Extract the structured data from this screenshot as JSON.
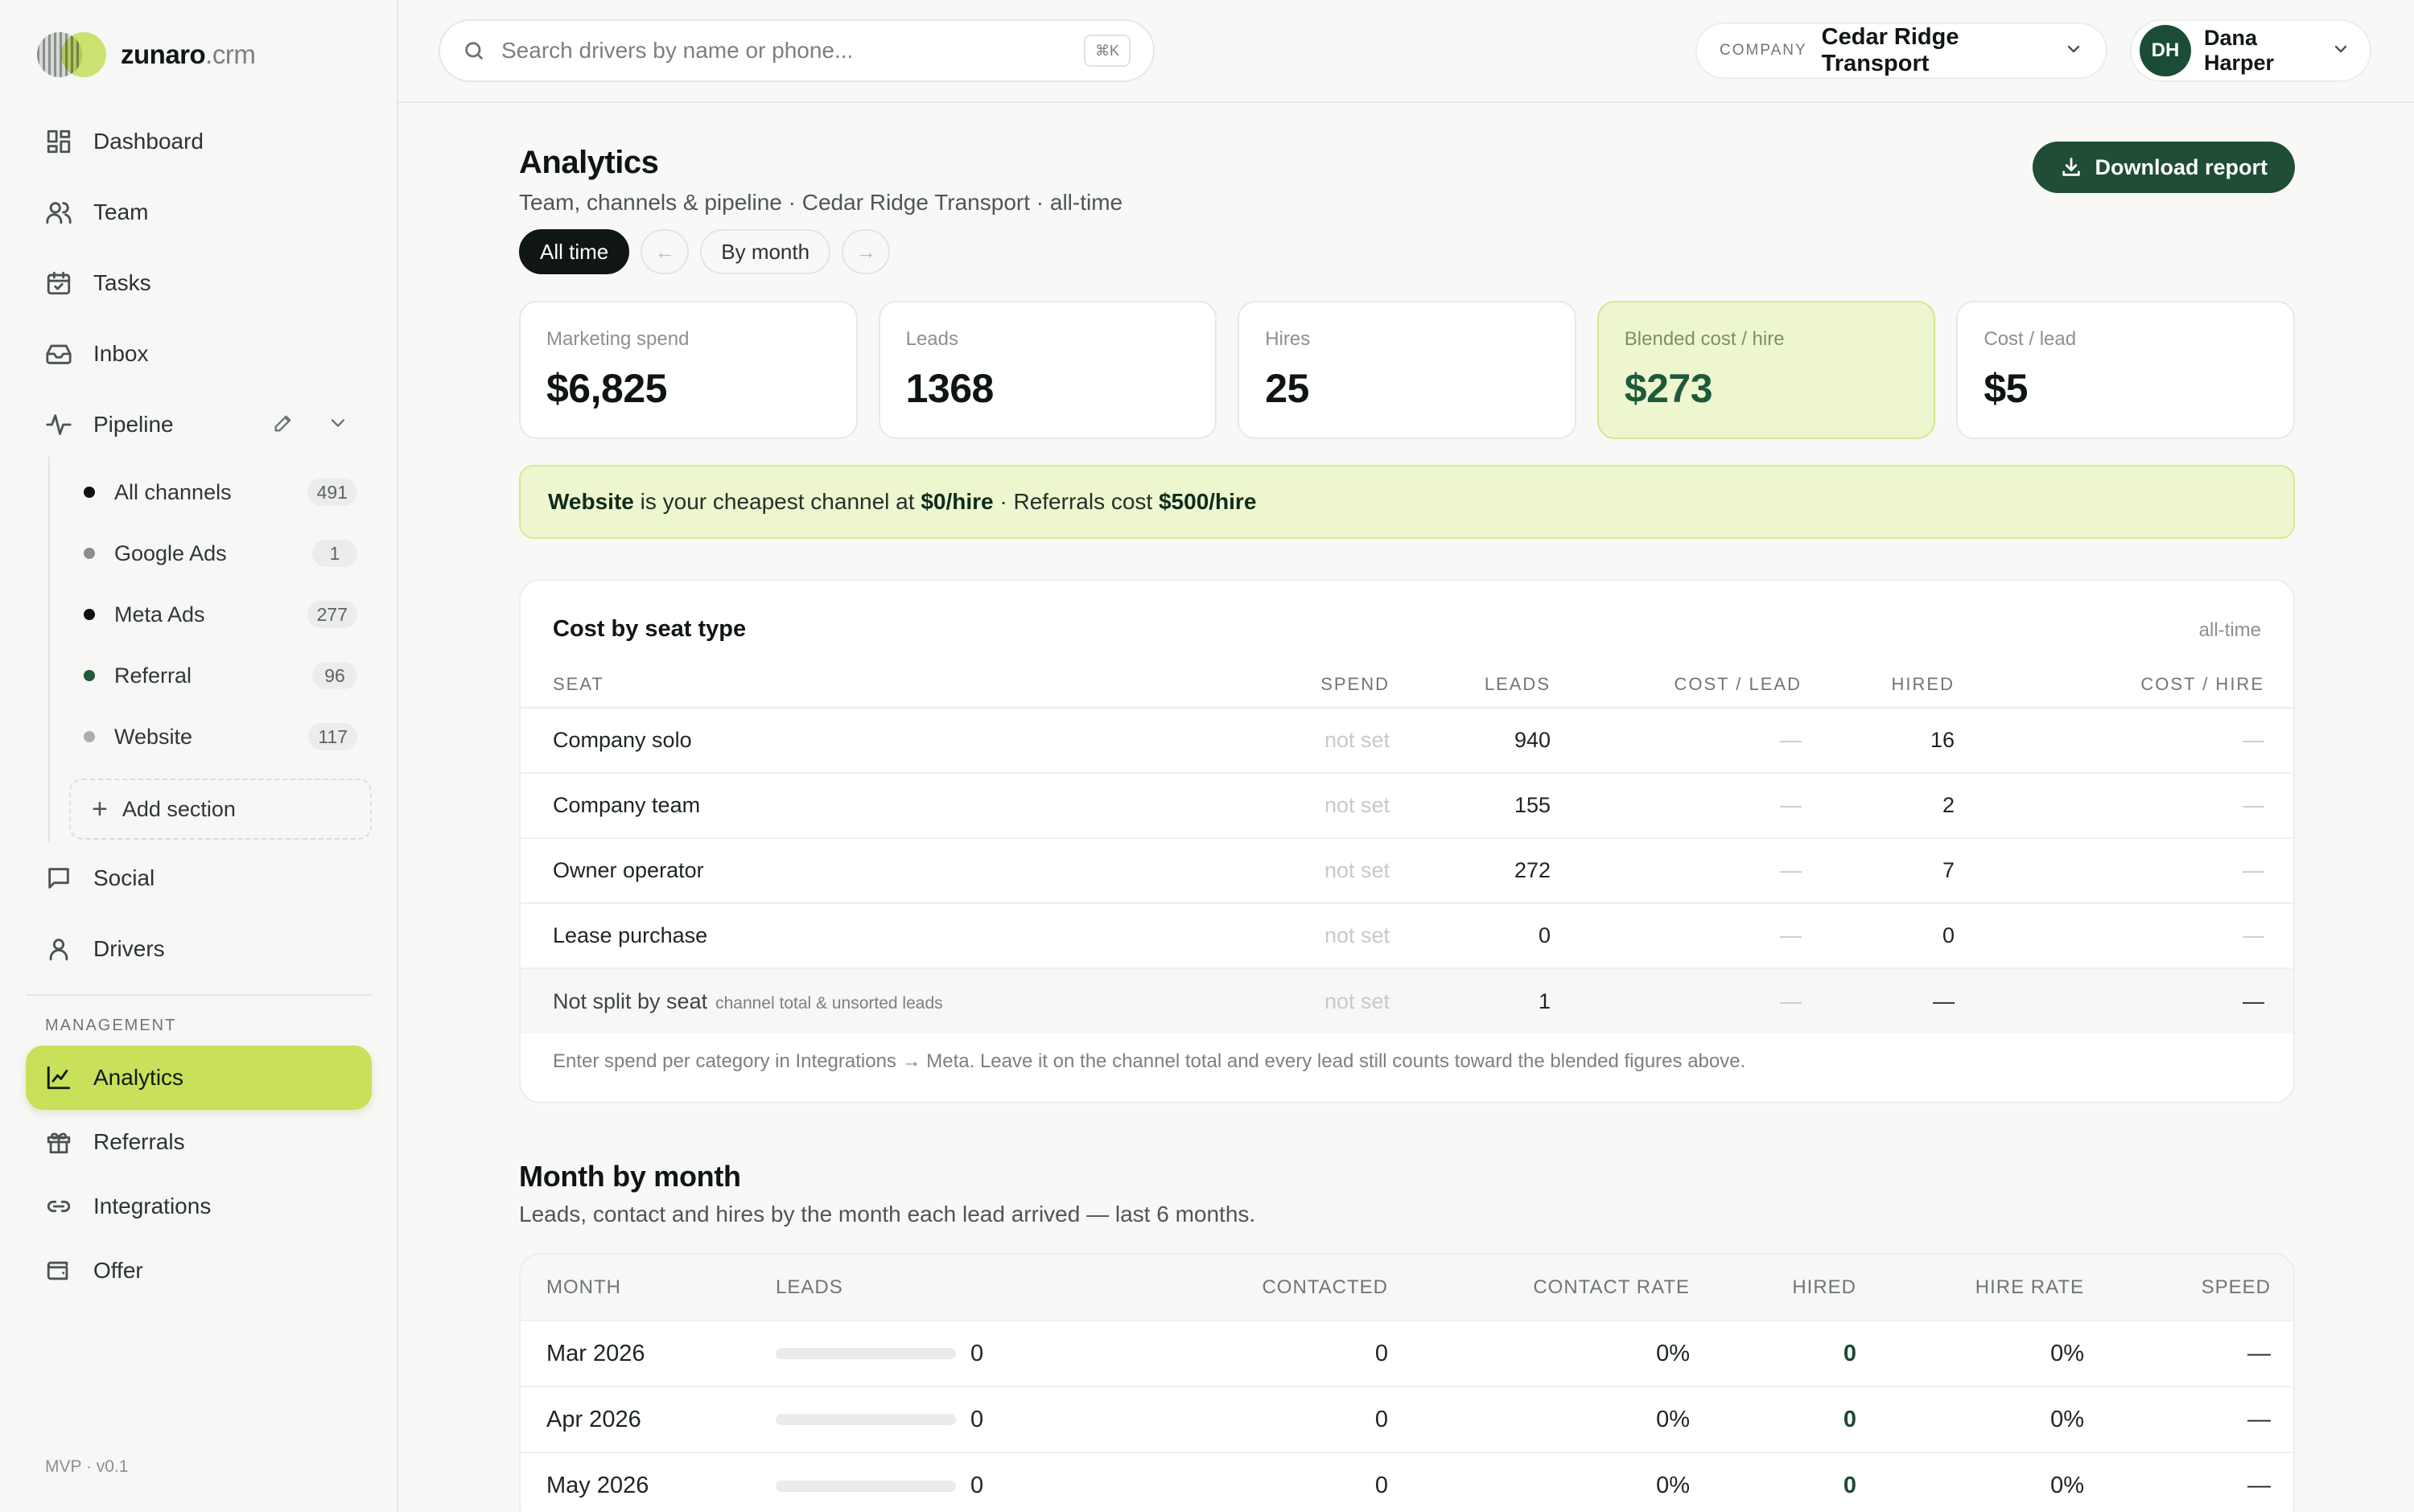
{
  "brand": {
    "name": "zunaro",
    "suffix": ".crm"
  },
  "sidebar": {
    "nav": [
      {
        "id": "dashboard",
        "label": "Dashboard",
        "icon": "grid-icon"
      },
      {
        "id": "team",
        "label": "Team",
        "icon": "users-icon"
      },
      {
        "id": "tasks",
        "label": "Tasks",
        "icon": "calendar-check-icon"
      },
      {
        "id": "inbox",
        "label": "Inbox",
        "icon": "inbox-icon"
      },
      {
        "id": "pipeline",
        "label": "Pipeline",
        "icon": "activity-icon"
      }
    ],
    "pipeline_sections": [
      {
        "label": "All channels",
        "count": "491",
        "dot_color": "#111111"
      },
      {
        "label": "Google Ads",
        "count": "1",
        "dot_color": "#8a8f8c"
      },
      {
        "label": "Meta Ads",
        "count": "277",
        "dot_color": "#111111"
      },
      {
        "label": "Referral",
        "count": "96",
        "dot_color": "#1f5a3a"
      },
      {
        "label": "Website",
        "count": "117",
        "dot_color": "#a9aeab"
      }
    ],
    "add_section_label": "Add section",
    "nav_after": [
      {
        "id": "social",
        "label": "Social",
        "icon": "message-icon"
      },
      {
        "id": "drivers",
        "label": "Drivers",
        "icon": "user-icon"
      }
    ],
    "management_label": "MANAGEMENT",
    "management": [
      {
        "id": "analytics",
        "label": "Analytics",
        "icon": "chart-line-icon",
        "active": true
      },
      {
        "id": "referrals",
        "label": "Referrals",
        "icon": "gift-icon"
      },
      {
        "id": "integrations",
        "label": "Integrations",
        "icon": "link-icon"
      },
      {
        "id": "offer",
        "label": "Offer",
        "icon": "wallet-icon"
      }
    ],
    "version": "MVP · v0.1"
  },
  "topbar": {
    "search_placeholder": "Search drivers by name or phone...",
    "search_shortcut": "⌘K",
    "company_label": "COMPANY",
    "company_value": "Cedar Ridge Transport",
    "user_initials": "DH",
    "user_name": "Dana Harper"
  },
  "page": {
    "title": "Analytics",
    "subtitle": "Team, channels & pipeline · Cedar Ridge Transport · all-time",
    "download_label": "Download report",
    "period": {
      "all_time": "All time",
      "prev": "←",
      "by_month": "By month",
      "next": "→"
    }
  },
  "kpis": [
    {
      "label": "Marketing spend",
      "value": "$6,825",
      "highlight": false
    },
    {
      "label": "Leads",
      "value": "1368",
      "highlight": false
    },
    {
      "label": "Hires",
      "value": "25",
      "highlight": false
    },
    {
      "label": "Blended cost / hire",
      "value": "$273",
      "highlight": true
    },
    {
      "label": "Cost / lead",
      "value": "$5",
      "highlight": false
    }
  ],
  "banner": {
    "channel": "Website",
    "text1": " is your cheapest channel at ",
    "cheap_cost": "$0/hire",
    "text2": " · Referrals cost ",
    "ref_cost": "$500/hire"
  },
  "seat_card": {
    "title": "Cost by seat type",
    "tag": "all-time",
    "columns": [
      "SEAT",
      "SPEND",
      "LEADS",
      "COST / LEAD",
      "HIRED",
      "COST / HIRE"
    ],
    "rows": [
      {
        "seat": "Company solo",
        "note": "",
        "spend": "not set",
        "leads": "940",
        "cpl": "—",
        "hired": "16",
        "cph": "—"
      },
      {
        "seat": "Company team",
        "note": "",
        "spend": "not set",
        "leads": "155",
        "cpl": "—",
        "hired": "2",
        "cph": "—"
      },
      {
        "seat": "Owner operator",
        "note": "",
        "spend": "not set",
        "leads": "272",
        "cpl": "—",
        "hired": "7",
        "cph": "—"
      },
      {
        "seat": "Lease purchase",
        "note": "",
        "spend": "not set",
        "leads": "0",
        "cpl": "—",
        "hired": "0",
        "cph": "—"
      },
      {
        "seat": "Not split by seat",
        "note": "channel total & unsorted leads",
        "spend": "not set",
        "leads": "1",
        "cpl": "—",
        "hired": "—",
        "cph": "—"
      }
    ],
    "footnote": "Enter spend per category in Integrations → Meta. Leave it on the channel total and every lead still counts toward the blended figures above."
  },
  "month_section": {
    "title": "Month by month",
    "subtitle": "Leads, contact and hires by the month each lead arrived — last 6 months.",
    "columns": [
      "MONTH",
      "LEADS",
      "CONTACTED",
      "CONTACT RATE",
      "HIRED",
      "HIRE RATE",
      "SPEED"
    ],
    "rows": [
      {
        "month": "Mar 2026",
        "leads": "0",
        "lead_fill": 0,
        "contacted": "0",
        "contact_rate": "0%",
        "hired": "0",
        "hire_rate": "0%",
        "speed": "—"
      },
      {
        "month": "Apr 2026",
        "leads": "0",
        "lead_fill": 0,
        "contacted": "0",
        "contact_rate": "0%",
        "hired": "0",
        "hire_rate": "0%",
        "speed": "—"
      },
      {
        "month": "May 2026",
        "leads": "0",
        "lead_fill": 0,
        "contacted": "0",
        "contact_rate": "0%",
        "hired": "0",
        "hire_rate": "0%",
        "speed": "—"
      }
    ]
  }
}
